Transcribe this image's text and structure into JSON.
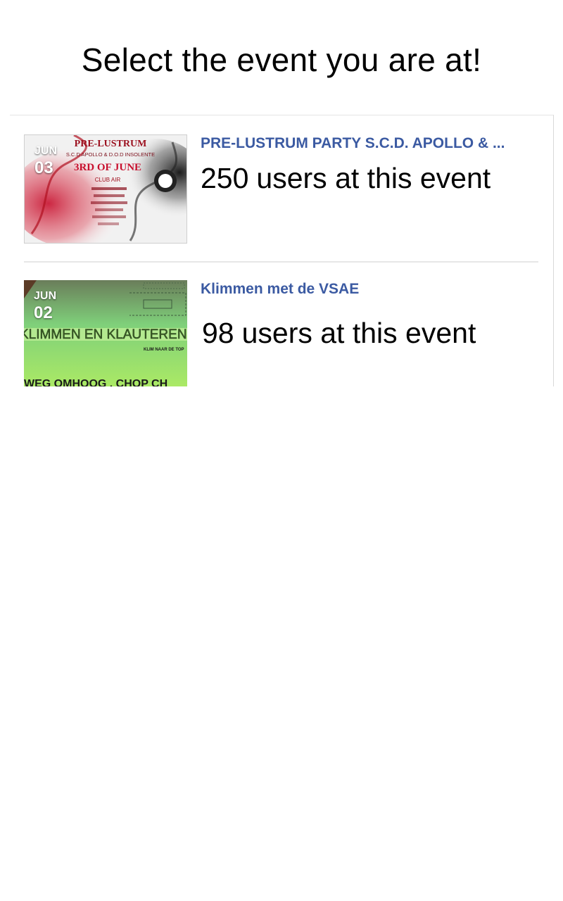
{
  "header": {
    "title": "Select the event you are at!"
  },
  "events": [
    {
      "month": "JUN",
      "day": "03",
      "title": "PRE-LUSTRUM PARTY S.C.D. APOLLO & ...",
      "user_count": "250",
      "count_suffix": "users at this event",
      "poster_text": {
        "line1": "PRE-LUSTRUM",
        "line2": "S.C.D APOLLO & D.O.D INSOLENTE",
        "line3": "3RD OF JUNE",
        "line4": "CLUB AIR"
      }
    },
    {
      "month": "JUN",
      "day": "02",
      "title": "Klimmen met de VSAE",
      "user_count": "98",
      "count_suffix": "users at this event",
      "poster_text": {
        "line1": "KLIMMEN EN KLAUTEREN",
        "line2": "KLIM NAAR DE TOP",
        "line3": "WEG OMHOOG . CHOP CH"
      }
    }
  ],
  "colors": {
    "title_link": "#3b5aa2",
    "divider": "#e6e6e6",
    "background": "#ffffff"
  }
}
